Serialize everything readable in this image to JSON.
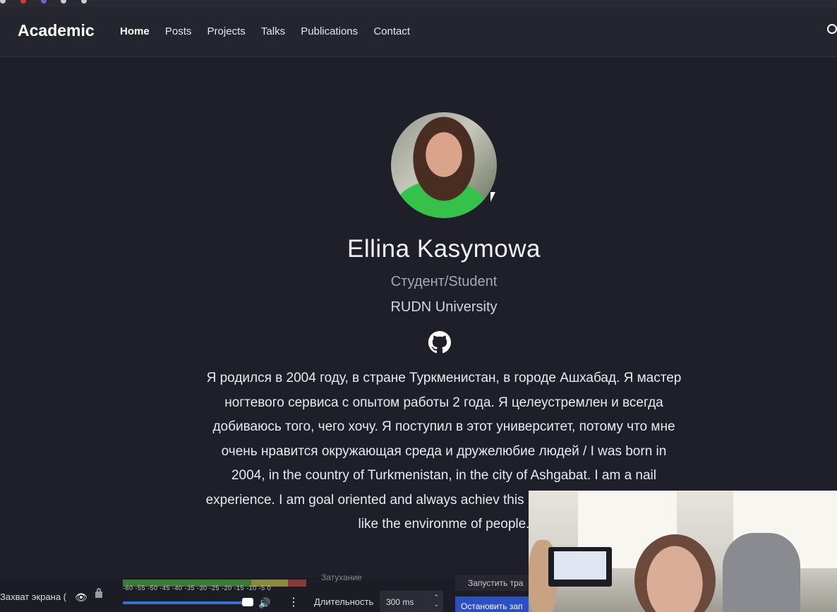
{
  "navbar": {
    "brand": "Academic",
    "links": [
      "Home",
      "Posts",
      "Projects",
      "Talks",
      "Publications",
      "Contact"
    ],
    "active": "Home"
  },
  "profile": {
    "name": "Ellina Kasymowa",
    "role": "Студент/Student",
    "organization": "RUDN University",
    "social": [
      "github-icon"
    ],
    "bio": "Я родился в 2004 году, в стране Туркменистан, в городе Ашхабад. Я мастер ногтевого сервиса с опытом работы 2 года. Я целеустремлен и всегда добиваюсь того, чего хочу. Я поступил в этот университет, потому что мне очень нравится окружающая среда и дружелюбие людей / I was born in 2004, in the country of Turkmenistan, in the city of Ashgabat. I am a nail                                experience. I am goal oriented and always achiev                                this university because I really like the environme                                of people."
  },
  "obs": {
    "source_label": "Захват экрана (",
    "meter_ticks": "-60 -55 -50 -45 -40 -35 -30 -25 -20 -15 -10 -5 0",
    "duration_label": "Длительность",
    "duration_value": "300 ms",
    "start_label": "Запустить тра",
    "stop_label": "Остановить зап",
    "faded_label": "Затухание"
  },
  "colors": {
    "background": "#1f1f29",
    "navbar": "#25252f",
    "accent_blue": "#2d4fc6"
  }
}
